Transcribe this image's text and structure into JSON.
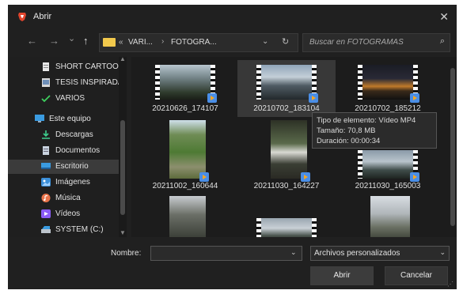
{
  "window": {
    "title": "Abrir",
    "close_glyph": "✕",
    "app_icon": "brave-lion-icon",
    "accent": "#e2452d"
  },
  "nav": {
    "back": "←",
    "forward": "→",
    "history": "⌄",
    "up": "↑",
    "breadcrumb_overflow": "«",
    "breadcrumbs": [
      "VARI...",
      "FOTOGRA..."
    ],
    "crumb_sep": "›",
    "dropdown": "⌄",
    "refresh": "↻"
  },
  "search": {
    "placeholder": "Buscar en FOTOGRAMAS",
    "icon": "⌕"
  },
  "sidebar": {
    "items": [
      {
        "label": "SHORT CARTOON",
        "icon": "document-icon"
      },
      {
        "label": "TESIS INSPIRADA",
        "icon": "image-doc-icon"
      },
      {
        "label": "VARIOS",
        "icon": "checkmark-icon"
      },
      {
        "label": "Este equipo",
        "icon": "monitor-icon"
      },
      {
        "label": "Descargas",
        "icon": "download-icon"
      },
      {
        "label": "Documentos",
        "icon": "documents-icon"
      },
      {
        "label": "Escritorio",
        "icon": "desktop-icon",
        "selected": true
      },
      {
        "label": "Imágenes",
        "icon": "pictures-icon"
      },
      {
        "label": "Música",
        "icon": "music-icon"
      },
      {
        "label": "Vídeos",
        "icon": "videos-icon"
      },
      {
        "label": "SYSTEM (C:)",
        "icon": "drive-icon"
      }
    ],
    "scroll_up": "▲",
    "scroll_down": "▼"
  },
  "files": [
    {
      "name": "20210626_174107"
    },
    {
      "name": "20210702_183104"
    },
    {
      "name": "20210702_185212"
    },
    {
      "name": "20211002_160644"
    },
    {
      "name": "20211030_164227"
    },
    {
      "name": "20211030_165003"
    },
    {
      "name": ""
    },
    {
      "name": ""
    },
    {
      "name": ""
    }
  ],
  "tooltip": {
    "lines": [
      "Tipo de elemento: Vídeo MP4",
      "Tamaño: 70,8 MB",
      "Duración: 00:00:34"
    ]
  },
  "footer": {
    "name_label": "Nombre:",
    "name_value": "",
    "dropdown": "⌄",
    "filetype": "Archivos personalizados",
    "open_label": "Abrir",
    "cancel_label": "Cancelar",
    "grip": "⋰"
  }
}
